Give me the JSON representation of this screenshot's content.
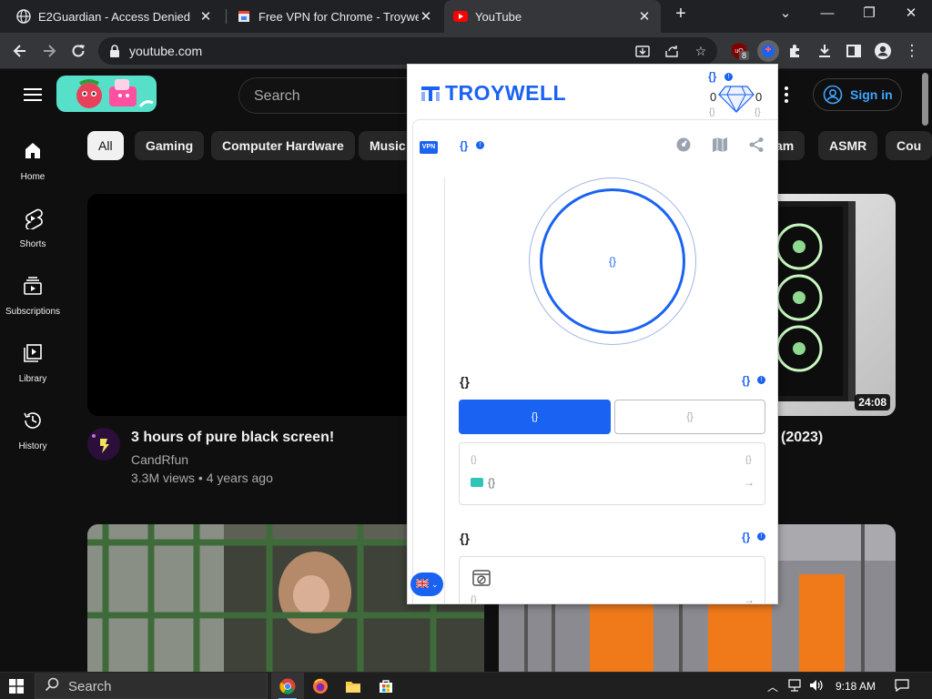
{
  "browser": {
    "tabs": [
      {
        "title": "E2Guardian - Access Denied",
        "icon": "globe-icon"
      },
      {
        "title": "Free VPN for Chrome - Troywell V",
        "icon": "store-icon"
      },
      {
        "title": "YouTube",
        "icon": "youtube-icon"
      }
    ],
    "active_tab": 2,
    "url": "youtube.com",
    "extension_badge_count": "8"
  },
  "youtube": {
    "search_placeholder": "Search",
    "signin_label": "Sign in",
    "nav": [
      {
        "label": "Home",
        "icon": "home-icon"
      },
      {
        "label": "Shorts",
        "icon": "shorts-icon"
      },
      {
        "label": "Subscriptions",
        "icon": "subscriptions-icon"
      },
      {
        "label": "Library",
        "icon": "library-icon"
      },
      {
        "label": "History",
        "icon": "history-icon"
      }
    ],
    "chips": [
      "All",
      "Gaming",
      "Computer Hardware",
      "Music",
      "am",
      "ASMR",
      "Cou"
    ],
    "videos": [
      {
        "title": "3 hours of pure black screen!",
        "channel": "CandRfun",
        "views": "3.3M views",
        "age": "4 years ago"
      },
      {
        "title_fragment": "(2023)",
        "duration": "24:08"
      }
    ],
    "meta_separator": "•"
  },
  "popup": {
    "brand": "TROYWELL",
    "placeholder": "{}",
    "gem_counts": [
      "0",
      "0"
    ],
    "vpn_badge": "VPN",
    "flag": "uk-flag-icon"
  },
  "taskbar": {
    "search_label": "Search",
    "time": "9:18 AM"
  },
  "colors": {
    "youtube_bg": "#0f0f0f",
    "troywell_blue": "#1a63f2",
    "signin_blue": "#3ea6ff"
  }
}
